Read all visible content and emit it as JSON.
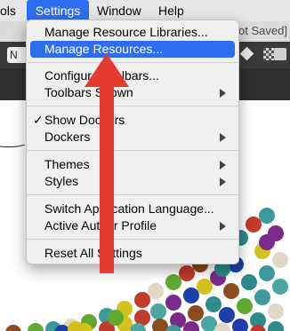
{
  "menubar": {
    "items": [
      "ols",
      "Settings",
      "Window",
      "Help"
    ]
  },
  "window": {
    "title_fragment": "Not Saved]",
    "toolbar_field": "N"
  },
  "settings_menu": {
    "items": [
      {
        "label": "Manage Resource Libraries..."
      },
      {
        "label": "Manage Resources..."
      },
      {
        "label": "Configure Toolbars..."
      },
      {
        "label": "Toolbars Shown"
      },
      {
        "label": "Show Dockers",
        "checkmark": "✓"
      },
      {
        "label": "Dockers"
      },
      {
        "label": "Themes"
      },
      {
        "label": "Styles"
      },
      {
        "label": "Switch Application Language..."
      },
      {
        "label": "Active Author Profile"
      },
      {
        "label": "Reset All Settings"
      }
    ],
    "highlighted_item": "Manage Resources...",
    "highlight_color": "#2d6ef0"
  },
  "annotation": {
    "arrow_color": "#e53b32"
  },
  "canvas": {
    "dot_colors": [
      "#3e9a9a",
      "#2e8b8b",
      "#4aa6a0",
      "#1c3fa8",
      "#7a2a8a",
      "#d4c21c",
      "#8a4b1e",
      "#c23a2a",
      "#5fa832",
      "#e0d8c4"
    ]
  }
}
